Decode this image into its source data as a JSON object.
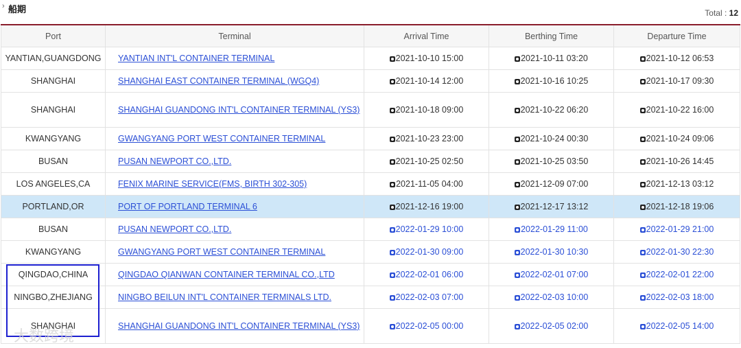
{
  "header": {
    "title": "船期",
    "total_label": "Total : ",
    "total_value": "12"
  },
  "columns": {
    "port": "Port",
    "terminal": "Terminal",
    "arrival": "Arrival Time",
    "berthing": "Berthing Time",
    "departure": "Departure Time"
  },
  "rows": [
    {
      "port": "YANTIAN,GUANGDONG",
      "terminal": "YANTIAN INT'L CONTAINER TERMINAL",
      "arrival": "2021-10-10 15:00",
      "berthing": "2021-10-11 03:20",
      "departure": "2021-10-12 06:53",
      "status": "actual"
    },
    {
      "port": "SHANGHAI",
      "terminal": "SHANGHAI EAST CONTAINER TERMINAL (WGQ4)",
      "arrival": "2021-10-14 12:00",
      "berthing": "2021-10-16 10:25",
      "departure": "2021-10-17 09:30",
      "status": "actual"
    },
    {
      "port": "SHANGHAI",
      "terminal": "SHANGHAI GUANDONG INT'L CONTAINER TERMINAL (YS3)",
      "arrival": "2021-10-18 09:00",
      "berthing": "2021-10-22 06:20",
      "departure": "2021-10-22 16:00",
      "status": "actual"
    },
    {
      "port": "KWANGYANG",
      "terminal": "GWANGYANG PORT WEST CONTAINER TERMINAL",
      "arrival": "2021-10-23 23:00",
      "berthing": "2021-10-24 00:30",
      "departure": "2021-10-24 09:06",
      "status": "actual"
    },
    {
      "port": "BUSAN",
      "terminal": "PUSAN NEWPORT CO.,LTD.",
      "arrival": "2021-10-25 02:50",
      "berthing": "2021-10-25 03:50",
      "departure": "2021-10-26 14:45",
      "status": "actual"
    },
    {
      "port": "LOS ANGELES,CA",
      "terminal": "FENIX MARINE SERVICE(FMS, BIRTH 302-305)",
      "arrival": "2021-11-05 04:00",
      "berthing": "2021-12-09 07:00",
      "departure": "2021-12-13 03:12",
      "status": "actual"
    },
    {
      "port": "PORTLAND,OR",
      "terminal": "PORT OF PORTLAND TERMINAL 6",
      "arrival": "2021-12-16 19:00",
      "berthing": "2021-12-17 13:12",
      "departure": "2021-12-18 19:06",
      "status": "actual",
      "highlight": true
    },
    {
      "port": "BUSAN",
      "terminal": "PUSAN NEWPORT CO.,LTD.",
      "arrival": "2022-01-29 10:00",
      "berthing": "2022-01-29 11:00",
      "departure": "2022-01-29 21:00",
      "status": "estimated"
    },
    {
      "port": "KWANGYANG",
      "terminal": "GWANGYANG PORT WEST CONTAINER TERMINAL",
      "arrival": "2022-01-30 09:00",
      "berthing": "2022-01-30 10:30",
      "departure": "2022-01-30 22:30",
      "status": "estimated"
    },
    {
      "port": "QINGDAO,CHINA",
      "terminal": "QINGDAO QIANWAN CONTAINER TERMINAL CO.,LTD",
      "arrival": "2022-02-01 06:00",
      "berthing": "2022-02-01 07:00",
      "departure": "2022-02-01 22:00",
      "status": "estimated"
    },
    {
      "port": "NINGBO,ZHEJIANG",
      "terminal": "NINGBO BEILUN INT'L CONTAINER TERMINALS LTD.",
      "arrival": "2022-02-03 07:00",
      "berthing": "2022-02-03 10:00",
      "departure": "2022-02-03 18:00",
      "status": "estimated"
    },
    {
      "port": "SHANGHAI",
      "terminal": "SHANGHAI GUANDONG INT'L CONTAINER TERMINAL (YS3)",
      "arrival": "2022-02-05 00:00",
      "berthing": "2022-02-05 02:00",
      "departure": "2022-02-05 14:00",
      "status": "estimated"
    }
  ],
  "watermark": "大数跨境",
  "colors": {
    "accent_rule": "#8a1d2b",
    "link": "#2b4fd6",
    "highlight_row": "#cfe7f8",
    "annotation_box": "#1c1fd0"
  },
  "icons": {
    "chevron": "chevron-right-icon",
    "time_actual": "actual-time-icon",
    "time_estimated": "estimated-time-icon"
  }
}
